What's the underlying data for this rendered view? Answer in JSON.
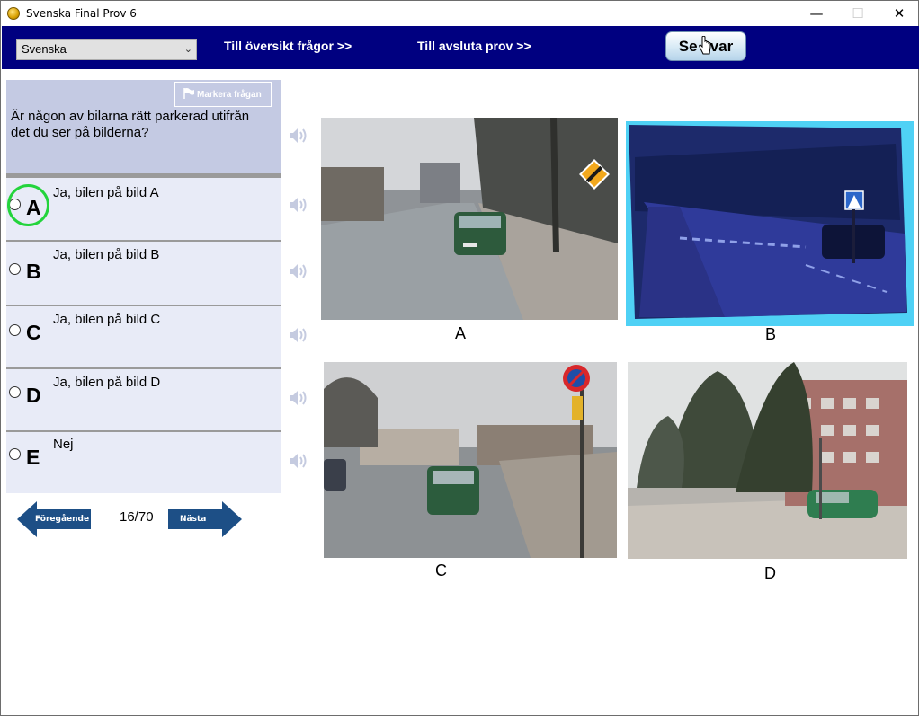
{
  "window": {
    "title": "Svenska Final Prov 6",
    "minimize": "—",
    "maximize": "☐",
    "close": "✕"
  },
  "topbar": {
    "language": "Svenska",
    "overview_link": "Till översikt frågor >>",
    "finish_link": "Till avsluta prov  >>",
    "answer_button": "Se svar"
  },
  "question": {
    "mark_button": "Markera frågan",
    "text": "Är någon av bilarna rätt parkerad utifrån det du ser på bilderna?"
  },
  "options": [
    {
      "letter": "A",
      "text": "Ja, bilen på bild A"
    },
    {
      "letter": "B",
      "text": "Ja, bilen på bild B"
    },
    {
      "letter": "C",
      "text": "Ja, bilen på bild C"
    },
    {
      "letter": "D",
      "text": "Ja, bilen på bild D"
    },
    {
      "letter": "E",
      "text": "Nej"
    }
  ],
  "navigation": {
    "previous": "Föregående",
    "next": "Nästa",
    "counter": "16/70"
  },
  "pictures": [
    {
      "label": "A"
    },
    {
      "label": "B"
    },
    {
      "label": "C"
    },
    {
      "label": "D"
    }
  ],
  "colors": {
    "topbar": "#000080",
    "question_bg": "#c4cae3",
    "option_bg": "#e8ebf7",
    "nav_arrow": "#1d4f86",
    "highlight_circle": "#23d43c"
  }
}
